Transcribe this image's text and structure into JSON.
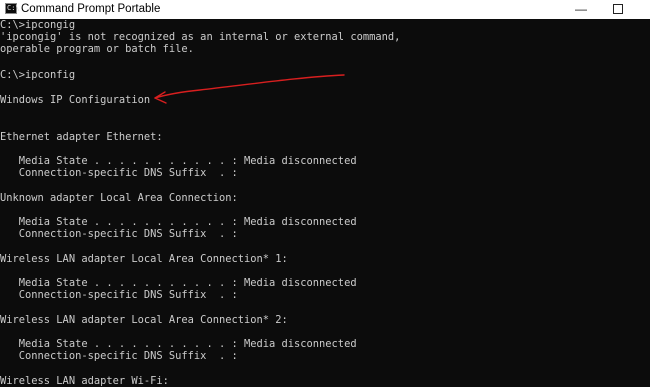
{
  "window": {
    "title": "Command Prompt Portable",
    "icon": "cmd-icon",
    "icon_glyph": "C:\\",
    "minimize_glyph": "—"
  },
  "console": {
    "lines": [
      "C:\\>ipcongig",
      "'ipcongig' is not recognized as an internal or external command,",
      "operable program or batch file.",
      "C:\\>ipconfig",
      "Windows IP Configuration",
      "Ethernet adapter Ethernet:",
      "   Media State . . . . . . . . . . . : Media disconnected",
      "   Connection-specific DNS Suffix  . :",
      "Unknown adapter Local Area Connection:",
      "   Media State . . . . . . . . . . . : Media disconnected",
      "   Connection-specific DNS Suffix  . :",
      "Wireless LAN adapter Local Area Connection* 1:",
      "   Media State . . . . . . . . . . . : Media disconnected",
      "   Connection-specific DNS Suffix  . :",
      "Wireless LAN adapter Local Area Connection* 2:",
      "   Media State . . . . . . . . . . . : Media disconnected",
      "   Connection-specific DNS Suffix  . :",
      "Wireless LAN adapter Wi-Fi:"
    ]
  },
  "colors": {
    "console_background": "#0c0c0c",
    "console_text": "#cccccc",
    "annotation_arrow": "#d81f1f",
    "titlebar": "#ffffff"
  }
}
